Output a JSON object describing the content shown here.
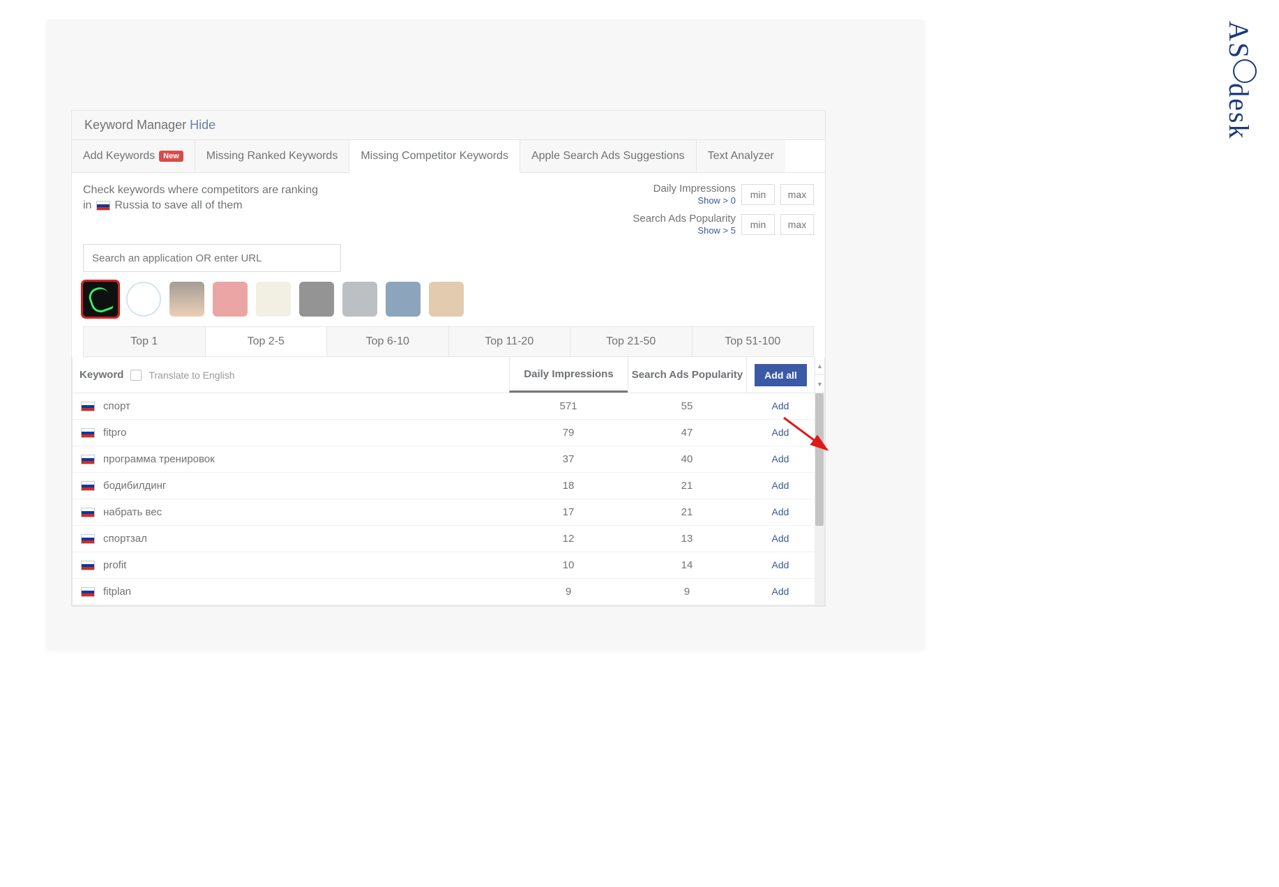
{
  "logo": "ASOdesk",
  "panel": {
    "title_prefix": "Keyword Manager",
    "hide": "Hide"
  },
  "tabs": [
    {
      "label": "Add Keywords",
      "badge": "New",
      "active": false
    },
    {
      "label": "Missing Ranked Keywords",
      "active": false
    },
    {
      "label": "Missing Competitor Keywords",
      "active": true
    },
    {
      "label": "Apple Search Ads Suggestions",
      "active": false
    },
    {
      "label": "Text Analyzer",
      "active": false
    }
  ],
  "desc": {
    "line1": "Check keywords where competitors are ranking",
    "line2a": "in",
    "country": "Russia",
    "line2b": "to save all of them"
  },
  "filters": {
    "di_label": "Daily Impressions",
    "di_link": "Show > 0",
    "sap_label": "Search Ads Popularity",
    "sap_link": "Show > 5",
    "min": "min",
    "max": "max"
  },
  "search_placeholder": "Search an application OR enter URL",
  "top_tabs": [
    {
      "label": "Top 1",
      "active": false
    },
    {
      "label": "Top 2-5",
      "active": true
    },
    {
      "label": "Top 6-10",
      "active": false
    },
    {
      "label": "Top 11-20",
      "active": false
    },
    {
      "label": "Top 21-50",
      "active": false
    },
    {
      "label": "Top 51-100",
      "active": false
    }
  ],
  "table": {
    "head": {
      "keyword": "Keyword",
      "translate": "Translate to English",
      "di": "Daily Impressions",
      "sap": "Search Ads Popularity",
      "add_all": "Add all"
    },
    "rows": [
      {
        "kw": "спорт",
        "di": "571",
        "sap": "55",
        "add": "Add"
      },
      {
        "kw": "fitpro",
        "di": "79",
        "sap": "47",
        "add": "Add"
      },
      {
        "kw": "программа тренировок",
        "di": "37",
        "sap": "40",
        "add": "Add"
      },
      {
        "kw": "бодибилдинг",
        "di": "18",
        "sap": "21",
        "add": "Add"
      },
      {
        "kw": "набрать вес",
        "di": "17",
        "sap": "21",
        "add": "Add"
      },
      {
        "kw": "спортзал",
        "di": "12",
        "sap": "13",
        "add": "Add"
      },
      {
        "kw": "profit",
        "di": "10",
        "sap": "14",
        "add": "Add"
      },
      {
        "kw": "fitplan",
        "di": "9",
        "sap": "9",
        "add": "Add"
      }
    ]
  }
}
